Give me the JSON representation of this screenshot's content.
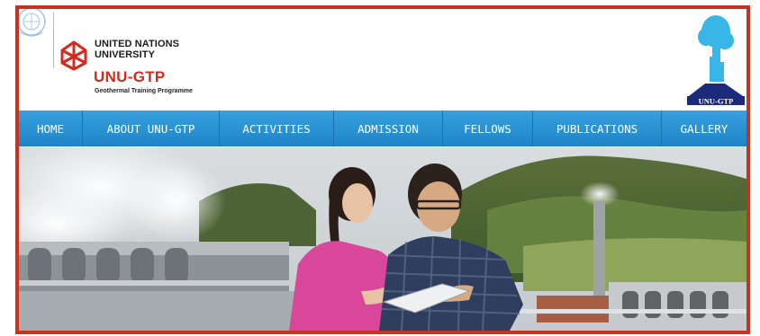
{
  "header": {
    "org_line_1": "UNITED NATIONS",
    "org_line_2": "UNIVERSITY",
    "programme_short": "UNU-GTP",
    "programme_full": "Geothermal Training Programme",
    "corner_logo_text": "UNU-GTP"
  },
  "nav": {
    "items": [
      {
        "label": "HOME"
      },
      {
        "label": "ABOUT UNU-GTP"
      },
      {
        "label": "ACTIVITIES"
      },
      {
        "label": "ADMISSION"
      },
      {
        "label": "FELLOWS"
      },
      {
        "label": "PUBLICATIONS"
      },
      {
        "label": "GALLERY"
      }
    ]
  },
  "hero": {
    "icon": "hero-photo"
  },
  "colors": {
    "frame_border": "#c8321f",
    "nav_background": "#2a94d6",
    "brand_red": "#d6291d",
    "logo_blue": "#39b6e8",
    "logo_navy": "#1b2a7a"
  }
}
